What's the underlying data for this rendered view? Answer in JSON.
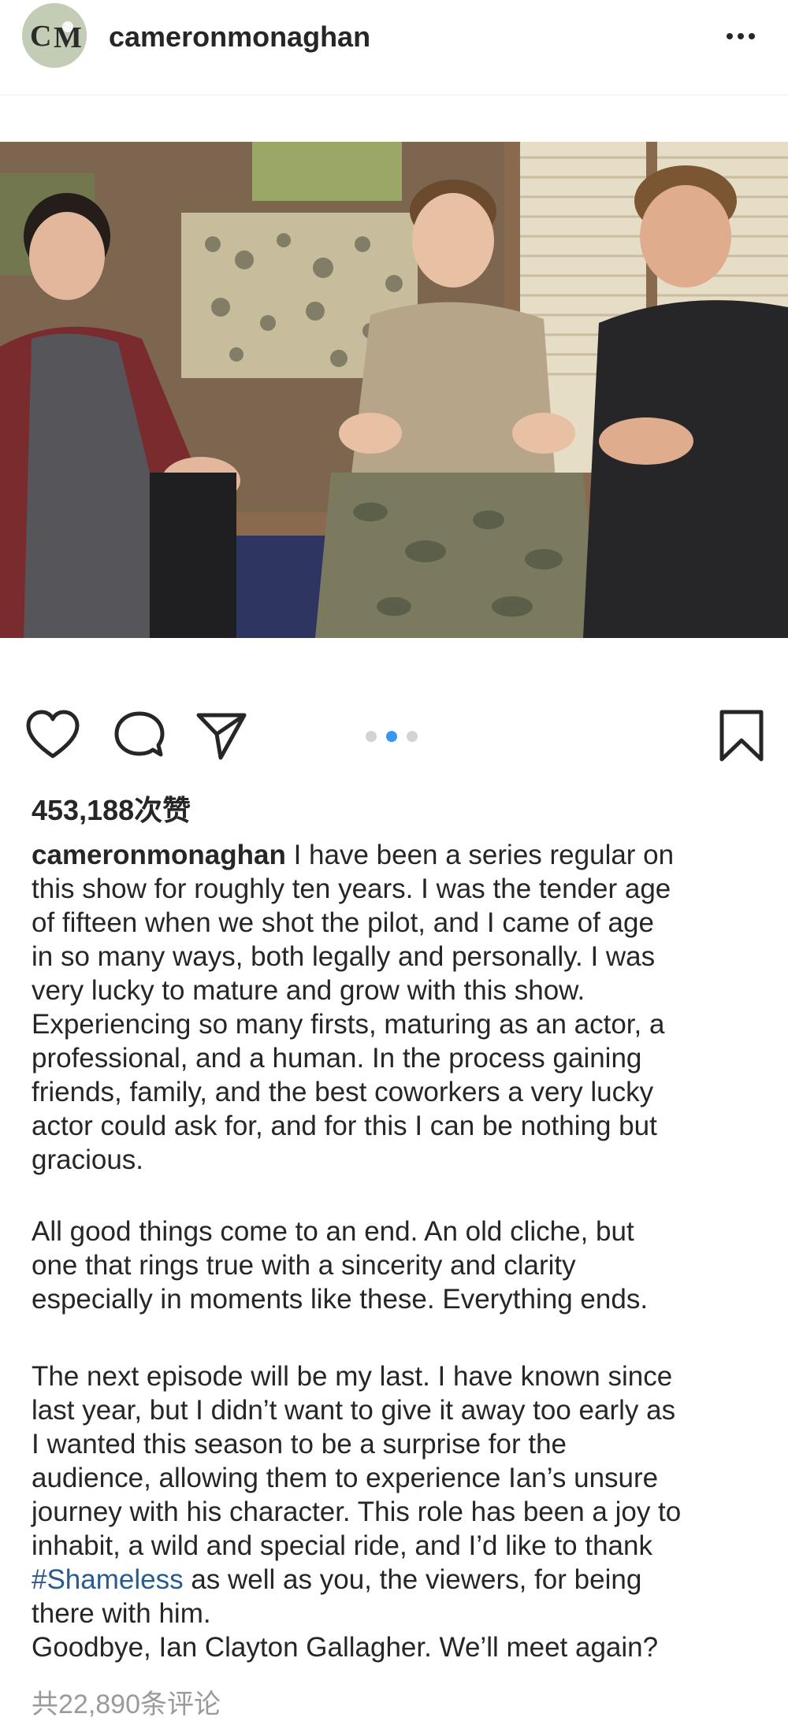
{
  "post": {
    "username": "cameronmonaghan",
    "avatar_icon": "profile-avatar-icon",
    "more_icon": "more-horizontal-icon",
    "photo_alt": "",
    "carousel": {
      "count": 3,
      "active_index": 1
    },
    "icons": {
      "like": "heart-icon",
      "comment": "comment-bubble-icon",
      "share": "paper-plane-icon",
      "save": "bookmark-icon"
    },
    "likes_text": "453,188次赞",
    "caption": {
      "owner": "cameronmonaghan",
      "p1_lines": [
        " I have been a series regular on",
        "this show for roughly ten years. I was the tender age",
        "of fifteen when we shot the pilot, and I came of age",
        "in so many ways, both legally and personally. I was",
        "very lucky to mature and grow with this show.",
        "Experiencing so many firsts, maturing as an actor, a",
        "professional, and a human. In the process gaining",
        "friends, family, and the best coworkers a very lucky",
        "actor could ask for, and for this I can be nothing but",
        "gracious."
      ],
      "p2_lines": [
        "All good things come to an end. An old cliche, but",
        "one that rings true with a sincerity and clarity",
        "especially in moments like these. Everything ends."
      ],
      "p3_lines": [
        "The next episode will be my last. I have known since",
        "last year, but I didn’t want to give it away too early as",
        "I wanted this season to be a surprise for the",
        "audience, allowing them to experience Ian’s unsure",
        "journey with his character. This role has been a joy to",
        "inhabit, a wild and special ride, and I’d like to thank"
      ],
      "hashtag": "#Shameless",
      "p3_after_hashtag": " as well as you, the viewers, for being",
      "p3_last": "there with him.",
      "goodbye": "Goodbye, Ian Clayton Gallagher. We’ll meet again?"
    },
    "comments_text": "共22,890条评论"
  }
}
